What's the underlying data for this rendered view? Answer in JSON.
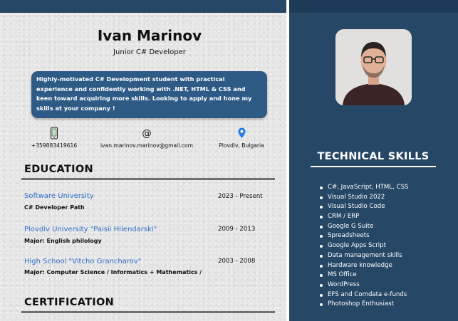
{
  "header": {
    "name": "Ivan Marinov",
    "role": "Junior C# Developer"
  },
  "summary": "Highly-motivated C# Development student with practical experience and confidently working with .NET, HTML & CSS and keen toward acquiring more skills. Looking to apply and hone my skills at your company !",
  "contact": {
    "phone": {
      "icon": "phone-icon",
      "text": "+359883419616"
    },
    "email": {
      "icon": "at-sign-icon",
      "text": "ivan.marinov.marinov@gmail.com"
    },
    "location": {
      "icon": "location-pin-icon",
      "text": "Plovdiv, Bulgaria"
    }
  },
  "education": {
    "title": "EDUCATION",
    "items": [
      {
        "school": "Software University",
        "detail": "C# Developer Path",
        "dates": "2023 - Present"
      },
      {
        "school": "Plovdiv University \"Paisii Hilendarski\"",
        "detail": "Major: English philology",
        "dates": "2009 - 2013"
      },
      {
        "school": "High School \"Vitcho Grancharov\"",
        "detail": "Major: Computer Science / Informatics + Mathematics /",
        "dates": "2003 - 2008"
      }
    ]
  },
  "certification": {
    "title": "CERTIFICATION"
  },
  "skills": {
    "title": "TECHNICAL SKILLS",
    "items": [
      "C#, JavaScript, HTML, CSS",
      "Visual Studio 2022",
      "Visual Studio Code",
      "CRM / ERP",
      "Google G Suite",
      "Spreadsheets",
      "Google Apps Script",
      "Data management skills",
      "Hardware knowledge",
      "MS Office",
      "WordPress",
      "EFS and Comdata e-funds",
      "Photoshop Enthusiast"
    ]
  },
  "colors": {
    "navy": "#274767",
    "summary_box": "#2e5b86",
    "link_blue": "#2f6fc8",
    "rule_gray": "#6f6f6f"
  }
}
